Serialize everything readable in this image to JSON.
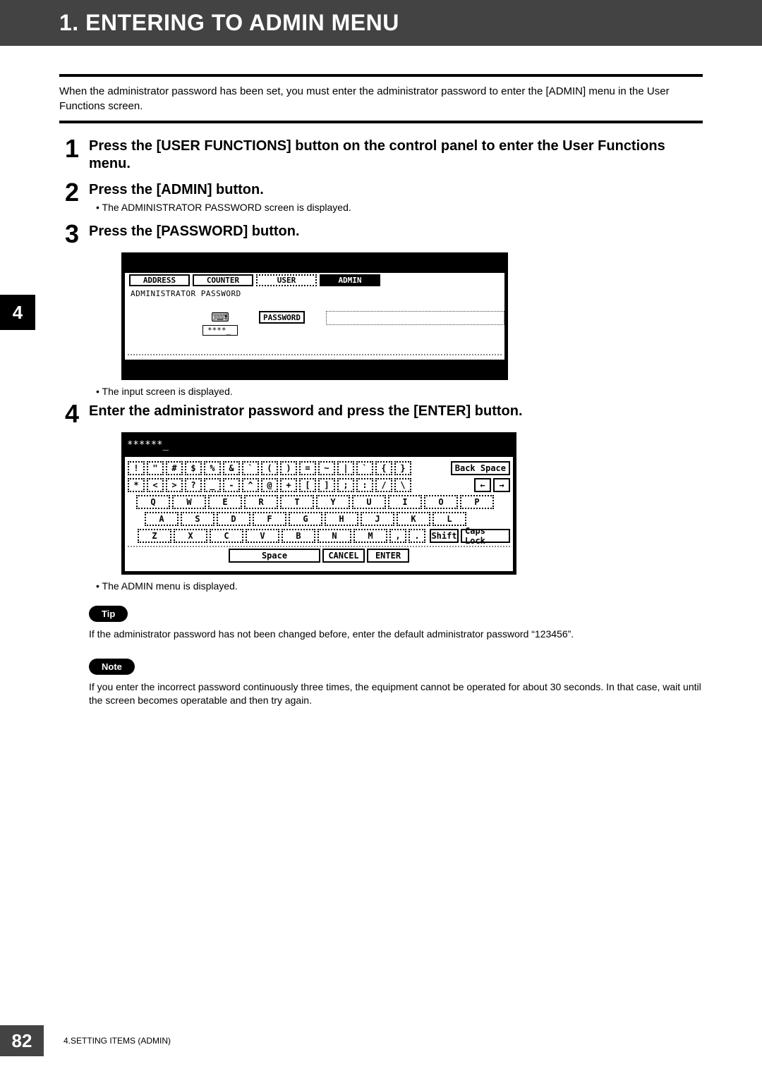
{
  "header_title": "1. ENTERING TO ADMIN MENU",
  "intro": "When the administrator password has been set, you must enter the administrator password to enter the [ADMIN] menu in the User Functions screen.",
  "side_chapter": "4",
  "steps": [
    {
      "num": "1",
      "title": "Press the [USER FUNCTIONS] button on the control panel to enter the User Functions menu."
    },
    {
      "num": "2",
      "title": "Press the [ADMIN] button.",
      "bullet": "The ADMINISTRATOR PASSWORD screen is displayed."
    },
    {
      "num": "3",
      "title": "Press the [PASSWORD] button.",
      "bullet_after": "The input screen is displayed."
    },
    {
      "num": "4",
      "title": "Enter the administrator password and press the [ENTER] button.",
      "bullet_after": "The ADMIN menu is displayed."
    }
  ],
  "screen1": {
    "tabs": [
      "ADDRESS",
      "COUNTER",
      "USER",
      "ADMIN"
    ],
    "label": "ADMINISTRATOR PASSWORD",
    "password_button": "PASSWORD",
    "mask": "****_"
  },
  "screen2": {
    "typed": "******_",
    "rows": {
      "r1": [
        "!",
        "\"",
        "#",
        "$",
        "%",
        "&",
        "`",
        "(",
        ")",
        "=",
        "~",
        "|",
        "`",
        "{",
        "}"
      ],
      "r1_right": "Back Space",
      "r2": [
        "*",
        "<",
        ">",
        "?",
        "_",
        "-",
        "^",
        "@",
        "+",
        "[",
        "]",
        ";",
        ":",
        "/",
        "\\"
      ],
      "r2_left": "←",
      "r2_right": "→",
      "r3": [
        "Q",
        "W",
        "E",
        "R",
        "T",
        "Y",
        "U",
        "I",
        "O",
        "P"
      ],
      "r4": [
        "A",
        "S",
        "D",
        "F",
        "G",
        "H",
        "J",
        "K",
        "L"
      ],
      "r5": [
        "Z",
        "X",
        "C",
        "V",
        "B",
        "N",
        "M",
        ",",
        "."
      ],
      "r5_shift": "Shift",
      "r5_caps": "Caps Lock",
      "r6_space": "Space",
      "r6_cancel": "CANCEL",
      "r6_enter": "ENTER"
    }
  },
  "tip_label": "Tip",
  "tip_text": "If the administrator password has not been changed before, enter the default administrator password “123456”.",
  "note_label": "Note",
  "note_text": "If you enter the incorrect password continuously three times, the equipment cannot be operated for about 30 seconds.  In that case, wait until the screen becomes operatable and then try again.",
  "page_number": "82",
  "footer_text": "4.SETTING ITEMS (ADMIN)"
}
